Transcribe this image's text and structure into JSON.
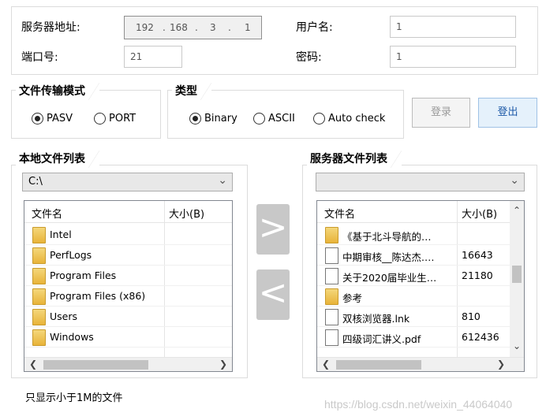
{
  "connection": {
    "server_label": "服务器地址:",
    "ip": {
      "o1": "192",
      "o2": "168",
      "o3": "3",
      "o4": "1",
      "dot": "."
    },
    "port_label": "端口号:",
    "port_value": "21",
    "user_label": "用户名:",
    "user_value": "1",
    "password_label": "密码:",
    "password_value": "1"
  },
  "transfer_mode": {
    "title": "文件传输模式",
    "options": [
      "PASV",
      "PORT"
    ],
    "selected": "PASV"
  },
  "type_group": {
    "title": "类型",
    "options": [
      "Binary",
      "ASCII",
      "Auto check"
    ],
    "selected": "Binary"
  },
  "buttons": {
    "login": "登录",
    "logout": "登出",
    "upload": ">",
    "download": "<"
  },
  "local": {
    "title": "本地文件列表",
    "path": "C:\\",
    "col_name": "文件名",
    "col_size": "大小(B)",
    "rows": [
      {
        "name": "Intel",
        "size": "",
        "icon": "folder"
      },
      {
        "name": "PerfLogs",
        "size": "",
        "icon": "folder"
      },
      {
        "name": "Program Files",
        "size": "",
        "icon": "folder"
      },
      {
        "name": "Program Files (x86)",
        "size": "",
        "icon": "folder"
      },
      {
        "name": "Users",
        "size": "",
        "icon": "folder"
      },
      {
        "name": "Windows",
        "size": "",
        "icon": "folder"
      }
    ]
  },
  "remote": {
    "title": "服务器文件列表",
    "path": "",
    "col_name": "文件名",
    "col_size": "大小(B)",
    "rows": [
      {
        "name": "《基于北斗导航的…",
        "size": "",
        "icon": "folder"
      },
      {
        "name": "中期审核__陈达杰.…",
        "size": "16643",
        "icon": "file"
      },
      {
        "name": "关于2020届毕业生…",
        "size": "21180",
        "icon": "file"
      },
      {
        "name": "参考",
        "size": "",
        "icon": "folder"
      },
      {
        "name": "双核浏览器.lnk",
        "size": "810",
        "icon": "file"
      },
      {
        "name": "四级词汇讲义.pdf",
        "size": "612436",
        "icon": "file"
      }
    ]
  },
  "note": "只显示小于1M的文件",
  "watermark": "https://blog.csdn.net/weixin_44064040",
  "icons": {
    "arrow": "chevron-down-icon",
    "left": "scroll-left-icon",
    "right": "scroll-right-icon",
    "up": "scroll-up-icon",
    "down": "scroll-down-icon"
  }
}
